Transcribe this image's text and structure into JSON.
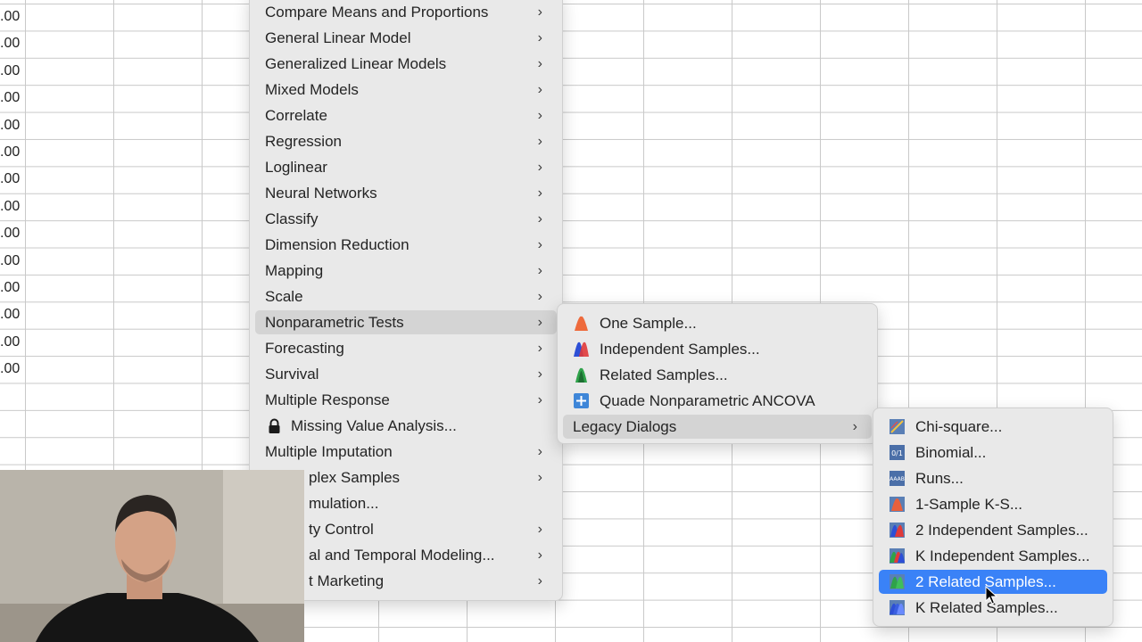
{
  "sheet": {
    "values": [
      ".00",
      ".00",
      ".00",
      ".00",
      ".00",
      ".00",
      ".00",
      ".00",
      ".00",
      ".00",
      ".00",
      ".00",
      ".00",
      ".00"
    ]
  },
  "analyze_menu": {
    "items": [
      {
        "label": "Compare Means and Proportions",
        "submenu": true
      },
      {
        "label": "General Linear Model",
        "submenu": true
      },
      {
        "label": "Generalized Linear Models",
        "submenu": true
      },
      {
        "label": "Mixed Models",
        "submenu": true
      },
      {
        "label": "Correlate",
        "submenu": true
      },
      {
        "label": "Regression",
        "submenu": true
      },
      {
        "label": "Loglinear",
        "submenu": true
      },
      {
        "label": "Neural Networks",
        "submenu": true
      },
      {
        "label": "Classify",
        "submenu": true
      },
      {
        "label": "Dimension Reduction",
        "submenu": true
      },
      {
        "label": "Mapping",
        "submenu": true
      },
      {
        "label": "Scale",
        "submenu": true
      },
      {
        "label": "Nonparametric Tests",
        "submenu": true
      },
      {
        "label": "Forecasting",
        "submenu": true
      },
      {
        "label": "Survival",
        "submenu": true
      },
      {
        "label": "Multiple Response",
        "submenu": true
      },
      {
        "label": "Missing Value Analysis...",
        "submenu": false,
        "icon": "lock-icon"
      },
      {
        "label": "Multiple Imputation",
        "submenu": true
      },
      {
        "label": "plex Samples",
        "submenu": true
      },
      {
        "label": "mulation...",
        "submenu": false
      },
      {
        "label": "ty Control",
        "submenu": true
      },
      {
        "label": "al and Temporal Modeling...",
        "submenu": true
      },
      {
        "label": "t Marketing",
        "submenu": true
      }
    ],
    "chevron": "›"
  },
  "nonparametric_menu": {
    "items": [
      {
        "label": "One Sample...",
        "icon": "one-sample-icon"
      },
      {
        "label": "Independent Samples...",
        "icon": "independent-samples-icon"
      },
      {
        "label": "Related Samples...",
        "icon": "related-samples-icon"
      },
      {
        "label": "Quade Nonparametric ANCOVA",
        "icon": "quade-ancova-icon"
      },
      {
        "label": "Legacy Dialogs",
        "submenu": true
      }
    ]
  },
  "legacy_menu": {
    "items": [
      {
        "label": "Chi-square...",
        "icon": "chi-square-icon"
      },
      {
        "label": "Binomial...",
        "icon": "binomial-icon"
      },
      {
        "label": "Runs...",
        "icon": "runs-icon"
      },
      {
        "label": "1-Sample K-S...",
        "icon": "one-sample-ks-icon"
      },
      {
        "label": "2 Independent Samples...",
        "icon": "two-independent-samples-icon"
      },
      {
        "label": "K Independent Samples...",
        "icon": "k-independent-samples-icon"
      },
      {
        "label": "2 Related Samples...",
        "icon": "two-related-samples-icon"
      },
      {
        "label": "K Related Samples...",
        "icon": "k-related-samples-icon"
      }
    ],
    "binomial_icon_text": "0/1",
    "runs_icon_text": "AAAB"
  },
  "colors": {
    "menu_bg": "#e9e9e9",
    "hover": "#d4d4d4",
    "selected": "#3a82f7"
  }
}
